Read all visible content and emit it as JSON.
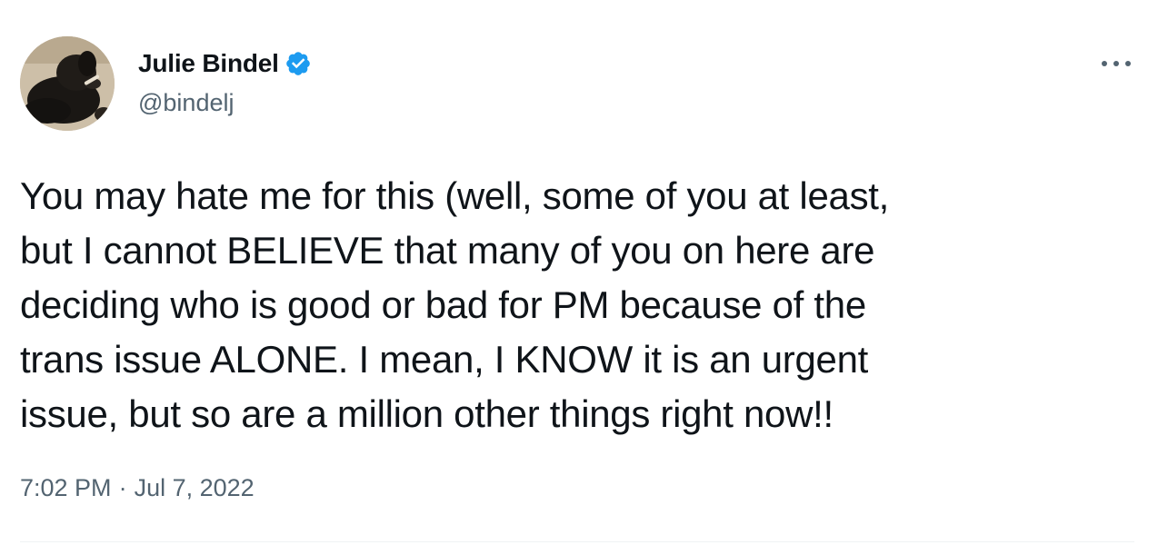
{
  "tweet": {
    "author": {
      "display_name": "Julie Bindel",
      "handle": "@bindelj",
      "verified": true,
      "avatar_icon": "profile-photo-dog"
    },
    "more_icon": "ellipsis-icon",
    "text": "You may hate me for this (well, some of you at least,\nbut I cannot BELIEVE that many of you on here are\ndeciding who is good or bad for PM because of the\ntrans issue ALONE. I mean, I KNOW it is an urgent\nissue, but so are a million other things right now!!",
    "time": "7:02 PM",
    "separator": "·",
    "date": "Jul 7, 2022"
  },
  "colors": {
    "text_primary": "#0f1419",
    "text_secondary": "#536471",
    "verified_blue": "#1d9bf0",
    "divider": "#eff3f4"
  }
}
